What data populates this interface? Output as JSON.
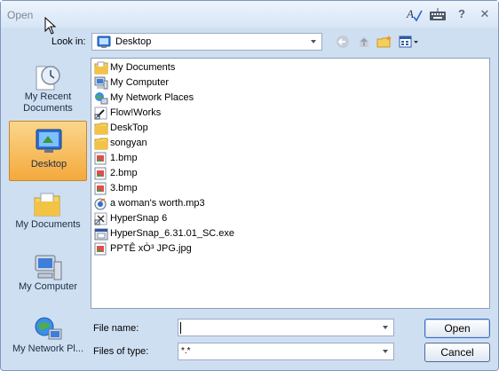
{
  "window": {
    "title": "Open"
  },
  "toolbar": {
    "look_in_label": "Look in:",
    "look_in_value": "Desktop",
    "help_glyph": "?",
    "close_glyph": "✕"
  },
  "places": [
    {
      "label": "My Recent Documents",
      "icon": "recent-documents-icon"
    },
    {
      "label": "Desktop",
      "icon": "desktop-icon",
      "selected": true
    },
    {
      "label": "My Documents",
      "icon": "my-documents-icon"
    },
    {
      "label": "My Computer",
      "icon": "my-computer-icon"
    },
    {
      "label": "My Network Pl...",
      "icon": "network-places-icon"
    }
  ],
  "files": [
    {
      "name": "My Documents",
      "icon": "folder-docs-icon"
    },
    {
      "name": "My Computer",
      "icon": "computer-icon"
    },
    {
      "name": "My Network Places",
      "icon": "network-icon"
    },
    {
      "name": "Flow!Works",
      "icon": "shortcut-icon"
    },
    {
      "name": "DeskTop",
      "icon": "folder-icon"
    },
    {
      "name": "songyan",
      "icon": "folder-icon"
    },
    {
      "name": "1.bmp",
      "icon": "bitmap-icon"
    },
    {
      "name": "2.bmp",
      "icon": "bitmap-icon"
    },
    {
      "name": "3.bmp",
      "icon": "bitmap-icon"
    },
    {
      "name": "a woman's worth.mp3",
      "icon": "audio-icon"
    },
    {
      "name": "HyperSnap 6",
      "icon": "hypersnap-icon"
    },
    {
      "name": "HyperSnap_6.31.01_SC.exe",
      "icon": "exe-icon"
    },
    {
      "name": "PPTÊ xÒ³ JPG.jpg",
      "icon": "jpg-icon"
    }
  ],
  "form": {
    "file_name_label": "File name:",
    "file_name_value": "",
    "files_of_type_label": "Files of type:",
    "files_of_type_value": "*.*"
  },
  "buttons": {
    "open": "Open",
    "cancel": "Cancel"
  },
  "colors": {
    "selected_place": "#f4a93c",
    "window_bg": "#cfdff2",
    "border": "#7d97bd"
  }
}
